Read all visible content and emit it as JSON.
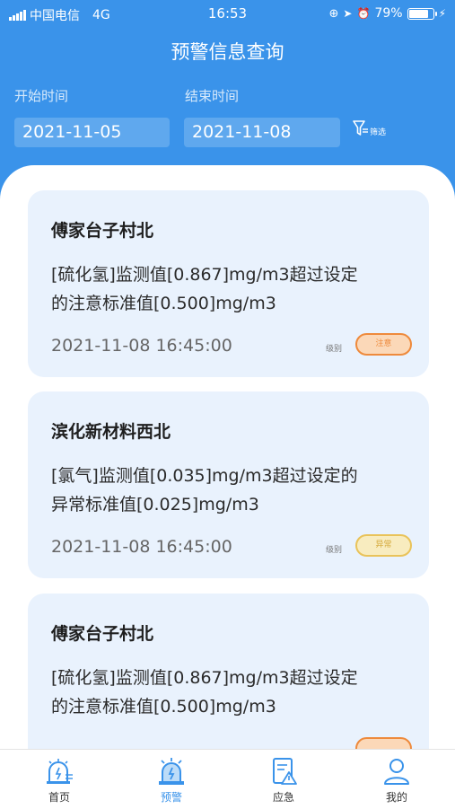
{
  "status_bar": {
    "carrier": "中国电信",
    "network": "4G",
    "time": "16:53",
    "battery": "79%"
  },
  "page_title": "预警信息查询",
  "filter": {
    "start_label": "开始时间",
    "start_value": "2021-11-05",
    "end_label": "结束时间",
    "end_value": "2021-11-08",
    "filter_label": "筛选"
  },
  "cards": [
    {
      "location": "傅家台子村北",
      "message_line1": "[硫化氢]监测值[0.867]mg/m3超过设定",
      "message_line2": "的注意标准值[0.500]mg/m3",
      "time": "2021-11-08 16:45:00",
      "level_label": "级别",
      "level": "注意",
      "level_color": "#ee8a3c",
      "level_bg": "#fbd8b8"
    },
    {
      "location": "滨化新材料西北",
      "message_line1": "[氯气]监测值[0.035]mg/m3超过设定的",
      "message_line2": "异常标准值[0.025]mg/m3",
      "time": "2021-11-08 16:45:00",
      "level_label": "级别",
      "level": "异常",
      "level_color": "#e9c35a",
      "level_bg": "#f8ecbf"
    },
    {
      "location": "傅家台子村北",
      "message_line1": "[硫化氢]监测值[0.867]mg/m3超过设定",
      "message_line2": "的注意标准值[0.500]mg/m3",
      "time": "",
      "level_label": "",
      "level": "",
      "level_color": "#ee8a3c",
      "level_bg": "#fbd8b8"
    }
  ],
  "tabs": [
    {
      "label": "首页",
      "icon": "home-alarm-icon",
      "active": false
    },
    {
      "label": "预警",
      "icon": "warning-siren-icon",
      "active": true
    },
    {
      "label": "应急",
      "icon": "emergency-doc-icon",
      "active": false
    },
    {
      "label": "我的",
      "icon": "user-icon",
      "active": false
    }
  ]
}
